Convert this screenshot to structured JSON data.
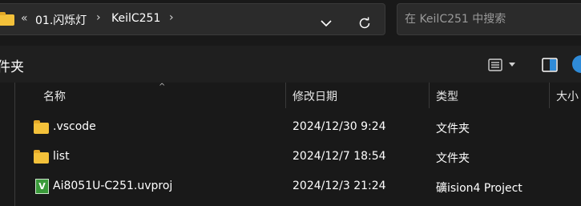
{
  "address_bar": {
    "overflow": "«",
    "crumbs": [
      "01.闪烁灯",
      "KeilC251"
    ],
    "separator": "›"
  },
  "search": {
    "placeholder": "在 KeilC251 中搜索"
  },
  "toolbar": {
    "title": "件夹"
  },
  "columns": {
    "name": "名称",
    "date_modified": "修改日期",
    "type": "类型",
    "size": "大小"
  },
  "files": [
    {
      "name": ".vscode",
      "date": "2024/12/30 9:24",
      "type": "文件夹",
      "icon": "folder-icon"
    },
    {
      "name": "list",
      "date": "2024/12/7 18:54",
      "type": "文件夹",
      "icon": "folder-icon"
    },
    {
      "name": "Ai8051U-C251.uvproj",
      "date": "2024/12/3 21:24",
      "type": "礦ision4 Project",
      "icon": "uvision-project-icon",
      "icon_text": "V"
    }
  ],
  "colors": {
    "background": "#191919",
    "toolbar": "#1f1f1f",
    "folder": "#f3c13a",
    "accent": "#2f8bd8"
  }
}
